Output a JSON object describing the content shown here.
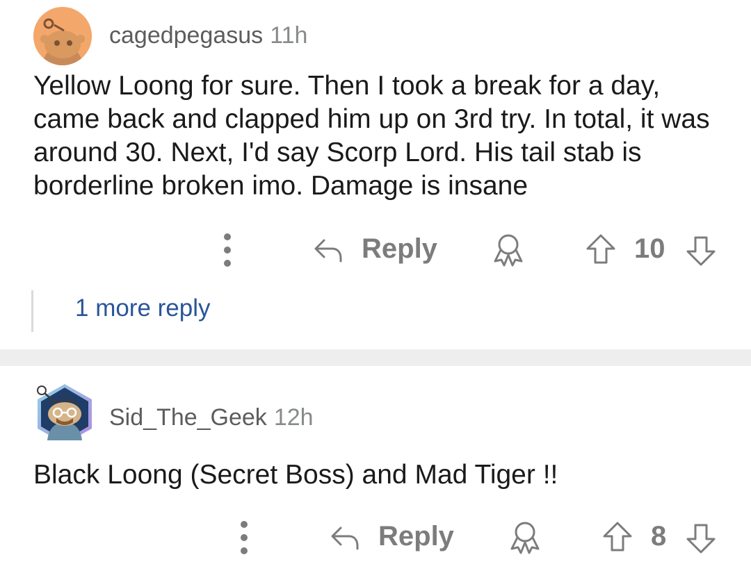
{
  "comments": [
    {
      "username": "cagedpegasus",
      "time": "11h",
      "body": "Yellow Loong for sure. Then I took a break for a day, came back and clapped him up on 3rd try. In total, it was around 30. Next, I'd say Scorp Lord. His tail stab is borderline broken imo. Damage is insane",
      "reply_label": "Reply",
      "score": "10",
      "more_replies": "1 more reply"
    },
    {
      "username": "Sid_The_Geek",
      "time": "12h",
      "body": "Black Loong (Secret Boss) and Mad Tiger !!",
      "reply_label": "Reply",
      "score": "8"
    }
  ],
  "icons": {
    "more": "kebab-icon",
    "reply": "reply-arrow-icon",
    "award": "award-icon",
    "upvote": "upvote-arrow-icon",
    "downvote": "downvote-arrow-icon"
  },
  "colors": {
    "link": "#2a5599",
    "muted": "#7c7c7c",
    "avatar_bg": "#f4a76b",
    "divider": "#eeeeef"
  }
}
